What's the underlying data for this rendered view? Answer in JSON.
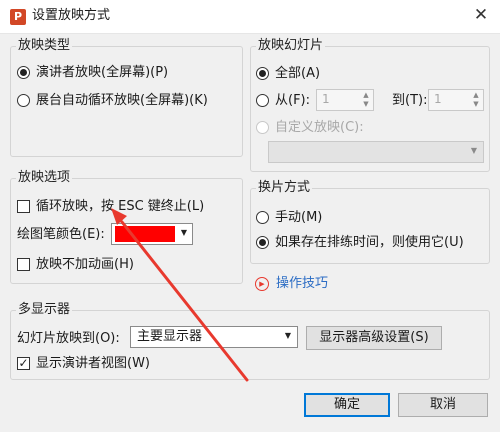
{
  "window": {
    "title": "设置放映方式",
    "app_icon_letter": "P"
  },
  "show_type": {
    "legend": "放映类型",
    "option_speaker": "演讲者放映(全屏幕)(P)",
    "option_kiosk": "展台自动循环放映(全屏幕)(K)",
    "selected": "speaker"
  },
  "show_slides": {
    "legend": "放映幻灯片",
    "option_all": "全部(A)",
    "option_from": "从(F):",
    "from_value": "1",
    "to_label": "到(T):",
    "to_value": "1",
    "option_custom": "自定义放映(C):",
    "selected": "all"
  },
  "show_options": {
    "legend": "放映选项",
    "loop_label": "循环放映，按 ESC 键终止(L)",
    "loop_checked": false,
    "pen_color_label": "绘图笔颜色(E):",
    "pen_color": "#ff0000",
    "no_animation_label": "放映不加动画(H)",
    "no_animation_checked": false
  },
  "advance": {
    "legend": "换片方式",
    "option_manual": "手动(M)",
    "option_timings": "如果存在排练时间，则使用它(U)",
    "selected": "timings"
  },
  "tips_link": "操作技巧",
  "multi_monitor": {
    "legend": "多显示器",
    "show_on_label": "幻灯片放映到(O):",
    "show_on_value": "主要显示器",
    "advanced_button": "显示器高级设置(S)",
    "presenter_view_label": "显示演讲者视图(W)",
    "presenter_view_checked": true
  },
  "buttons": {
    "ok": "确定",
    "cancel": "取消"
  },
  "colors": {
    "accent": "#0078d7",
    "link": "#2b6cc4",
    "annotation_arrow": "#e8392e"
  }
}
